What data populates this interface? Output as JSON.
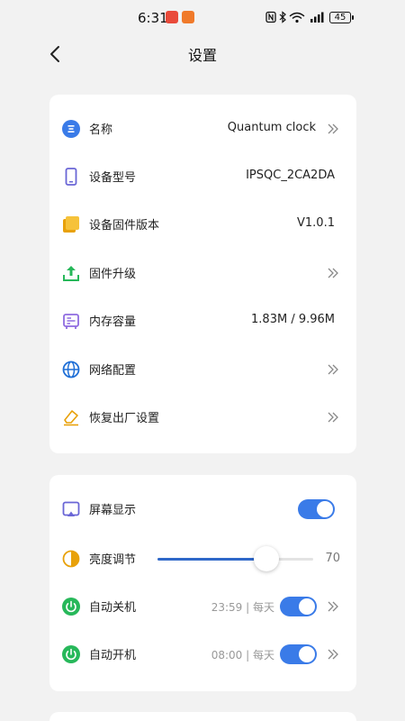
{
  "status": {
    "time": "6:31",
    "battery": "45",
    "icons": [
      "nfc-icon",
      "bluetooth-icon",
      "wifi-icon",
      "signal-icon"
    ]
  },
  "header": {
    "title": "设置"
  },
  "info": {
    "items": [
      {
        "label": "名称",
        "value": "Quantum clock",
        "icon": "name-icon"
      },
      {
        "label": "设备型号",
        "value": "IPSQC_2CA2DA",
        "icon": "phone-icon"
      },
      {
        "label": "设备固件版本",
        "value": "V1.0.1",
        "icon": "folder-icon"
      },
      {
        "label": "固件升级",
        "value": "",
        "icon": "upload-icon"
      },
      {
        "label": "内存容量",
        "value": "1.83M / 9.96M",
        "icon": "memory-icon"
      },
      {
        "label": "网络配置",
        "value": "",
        "icon": "globe-icon"
      },
      {
        "label": "恢复出厂设置",
        "value": "",
        "icon": "eraser-icon"
      }
    ]
  },
  "display": {
    "screen": {
      "label": "屏幕显示",
      "on": true
    },
    "brightness": {
      "label": "亮度调节",
      "value": 70,
      "max": 100
    },
    "auto_off": {
      "label": "自动关机",
      "schedule": "23:59 | 每天",
      "on": true
    },
    "auto_on": {
      "label": "自动开机",
      "schedule": "08:00 | 每天",
      "on": true
    }
  },
  "colors": {
    "accent": "#3a7be8",
    "slider": "#2f68c9",
    "background": "#f2f2f2"
  }
}
